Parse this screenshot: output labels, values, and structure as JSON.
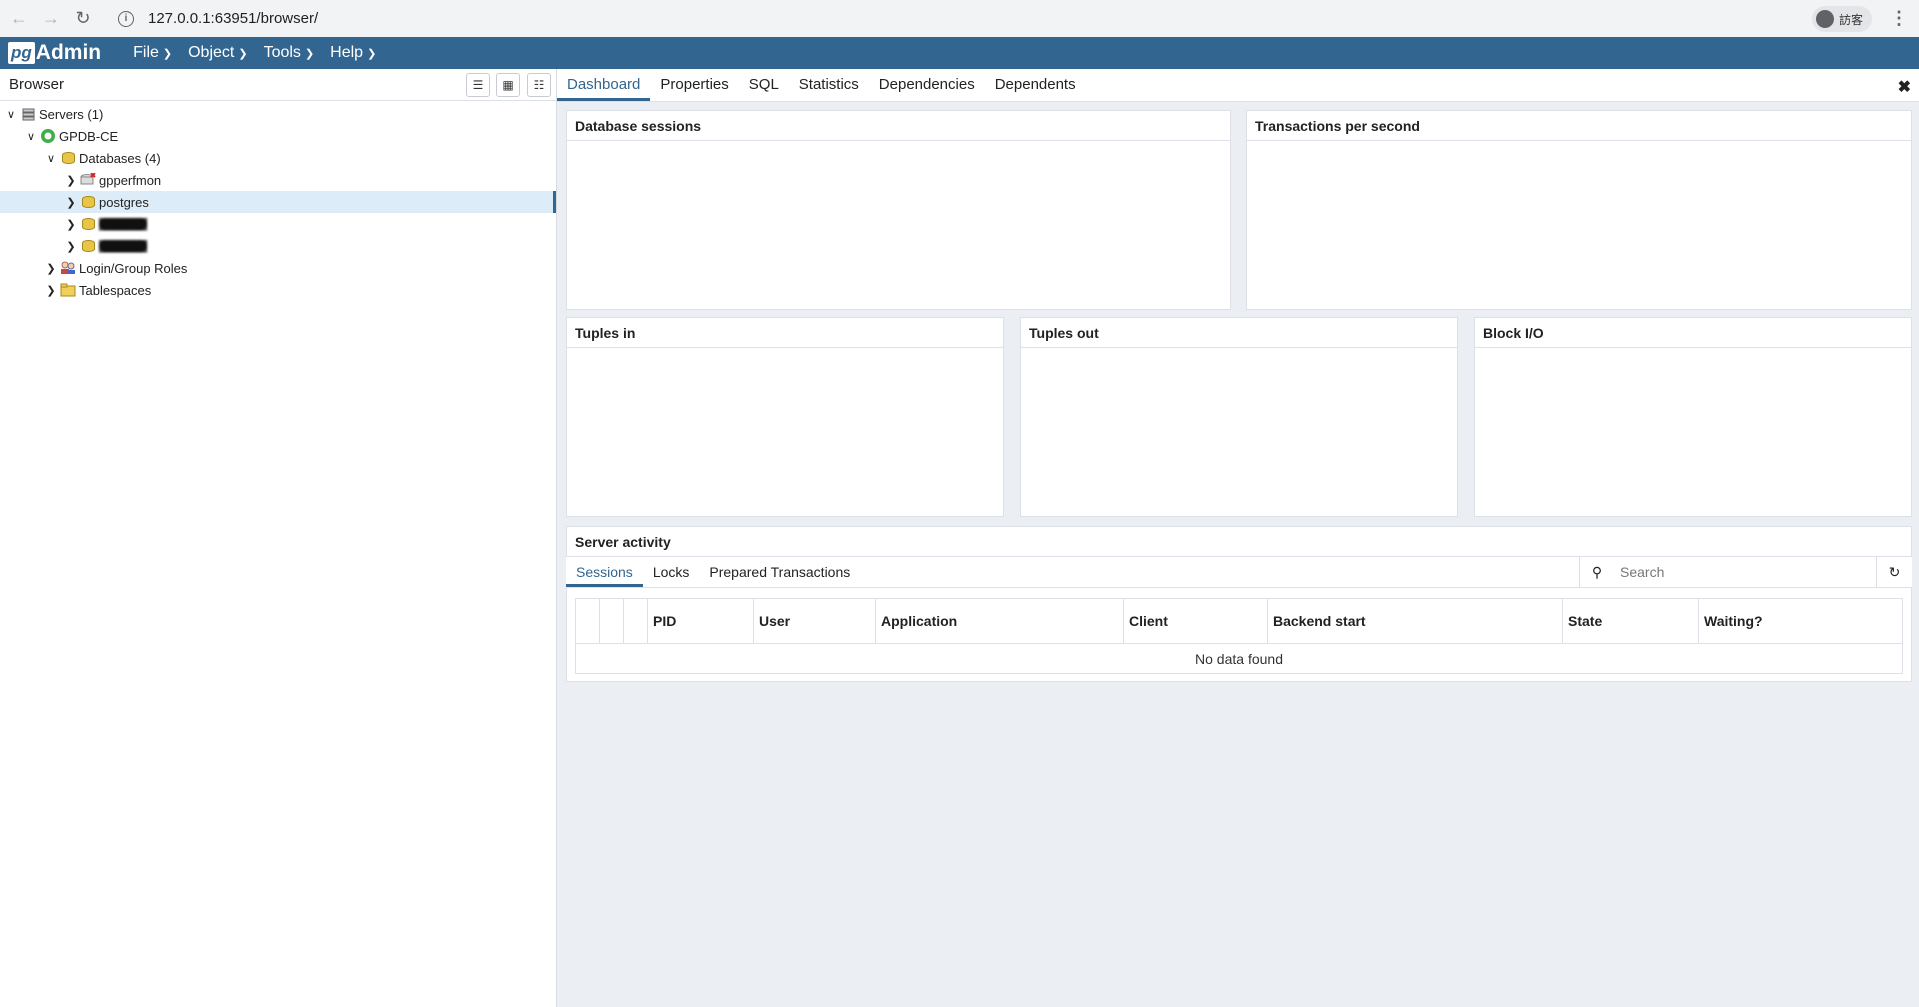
{
  "browser": {
    "url": "127.0.0.1:63951/browser/",
    "profile_label": "訪客"
  },
  "app": {
    "logo_pg": "pg",
    "logo_admin": "Admin",
    "menu": [
      {
        "label": "File"
      },
      {
        "label": "Object"
      },
      {
        "label": "Tools"
      },
      {
        "label": "Help"
      }
    ]
  },
  "browser_panel": {
    "title": "Browser",
    "tree": {
      "servers": "Servers (1)",
      "server": "GPDB-CE",
      "databases": "Databases (4)",
      "db_items": [
        "gpperfmon",
        "postgres",
        "▓▓▓▓▓▓",
        "▓▓▓▓▓▓"
      ],
      "login_roles": "Login/Group Roles",
      "tablespaces": "Tablespaces"
    }
  },
  "main_tabs": [
    {
      "label": "Dashboard",
      "active": true
    },
    {
      "label": "Properties"
    },
    {
      "label": "SQL"
    },
    {
      "label": "Statistics"
    },
    {
      "label": "Dependencies"
    },
    {
      "label": "Dependents"
    }
  ],
  "dashboard": {
    "db_sessions": "Database sessions",
    "tps": "Transactions per second",
    "tuples_in": "Tuples in",
    "tuples_out": "Tuples out",
    "block_io": "Block I/O",
    "server_activity": "Server activity"
  },
  "activity_tabs": [
    {
      "label": "Sessions",
      "active": true
    },
    {
      "label": "Locks"
    },
    {
      "label": "Prepared Transactions"
    }
  ],
  "search": {
    "placeholder": "Search"
  },
  "table": {
    "columns": [
      "PID",
      "User",
      "Application",
      "Client",
      "Backend start",
      "State",
      "Waiting?"
    ],
    "empty_text": "No data found"
  },
  "colors": {
    "brand": "#326690",
    "selected_row": "#dcecf9"
  }
}
